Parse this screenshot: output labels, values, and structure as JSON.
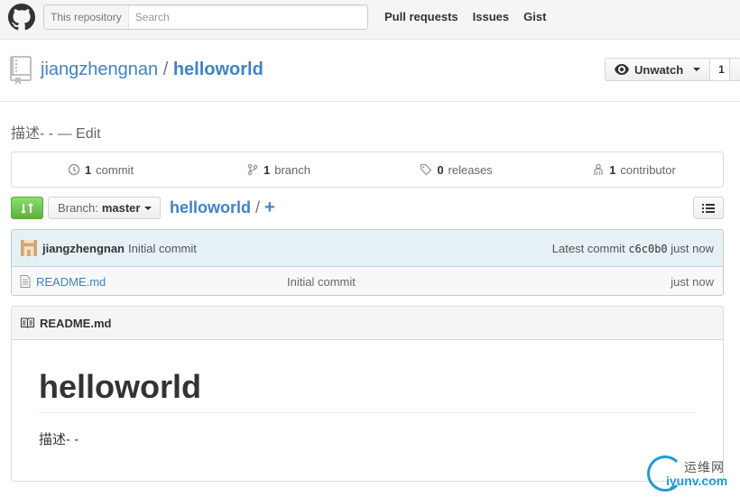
{
  "header": {
    "search_scope": "This repository",
    "search_placeholder": "Search",
    "nav": [
      "Pull requests",
      "Issues",
      "Gist"
    ]
  },
  "repo": {
    "owner": "jiangzhengnan",
    "separator": "/",
    "name": "helloworld",
    "watch_label": "Unwatch",
    "watch_count": "1"
  },
  "description": {
    "text": "描述- -",
    "dash": "—",
    "edit_label": "Edit"
  },
  "summary": {
    "commits": {
      "count": "1",
      "label": "commit"
    },
    "branches": {
      "count": "1",
      "label": "branch"
    },
    "releases": {
      "count": "0",
      "label": "releases"
    },
    "contributors": {
      "count": "1",
      "label": "contributor"
    }
  },
  "file_nav": {
    "branch_prefix": "Branch:",
    "branch_name": "master",
    "breadcrumb_repo": "helloworld",
    "breadcrumb_sep": "/",
    "add_file": "+"
  },
  "commit_tease": {
    "author": "jiangzhengnan",
    "message": "Initial commit",
    "latest_label": "Latest commit",
    "sha": "c6c0b0",
    "time": "just now"
  },
  "files": [
    {
      "name": "README.md",
      "message": "Initial commit",
      "age": "just now"
    }
  ],
  "readme": {
    "filename": "README.md",
    "heading": "helloworld",
    "paragraph": "描述- -"
  },
  "watermark": {
    "text": "运维网",
    "url": "iyunv.com"
  },
  "colors": {
    "link": "#4183c4",
    "compare_green": "#60b044",
    "commit_tease_bg": "#e6f1f6",
    "header_bg": "#f5f5f5"
  }
}
